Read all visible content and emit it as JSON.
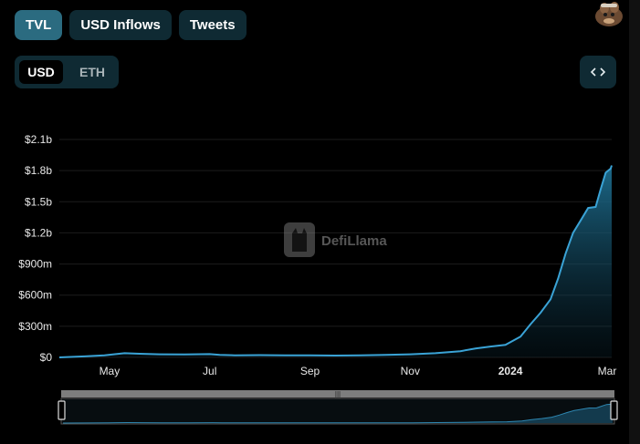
{
  "tabs": [
    {
      "label": "TVL",
      "active": true
    },
    {
      "label": "USD Inflows",
      "active": false
    },
    {
      "label": "Tweets",
      "active": false
    }
  ],
  "denomination": {
    "options": [
      "USD",
      "ETH"
    ],
    "selected": "USD"
  },
  "embed_icon": "code-brackets-icon",
  "avatar_icon": "llama-avatar-icon",
  "watermark": "DefiLlama",
  "colors": {
    "line": "#3aa3d6",
    "accent": "#2b6b80",
    "panel": "#0f2a33"
  },
  "chart_data": {
    "type": "area",
    "title": "",
    "xlabel": "",
    "ylabel": "",
    "x_tick_labels": [
      "May",
      "Jul",
      "Sep",
      "Nov",
      "2024",
      "Mar"
    ],
    "x_tick_months": [
      4,
      6,
      8,
      10,
      12,
      14
    ],
    "x_range_months": [
      3,
      14.02
    ],
    "y_tick_labels": [
      "$0",
      "$300m",
      "$600m",
      "$900m",
      "$1.2b",
      "$1.5b",
      "$1.8b",
      "$2.1b"
    ],
    "y_tick_values": [
      0,
      300,
      600,
      900,
      1200,
      1500,
      1800,
      2100
    ],
    "ylim": [
      0,
      2100
    ],
    "y_unit": "USD millions",
    "grid": true,
    "series": [
      {
        "x": [
          3.0,
          3.5,
          3.9,
          4.3,
          4.6,
          5.0,
          5.5,
          6.0,
          6.2,
          6.5,
          7.0,
          7.5,
          8.0,
          8.5,
          9.0,
          9.5,
          10.0,
          10.5,
          11.0,
          11.3,
          11.6,
          11.9,
          12.2,
          12.4,
          12.6,
          12.8,
          12.95,
          13.1,
          13.25,
          13.4,
          13.55,
          13.7,
          13.8,
          13.9,
          14.0,
          14.02
        ],
        "y": [
          0,
          10,
          20,
          40,
          35,
          30,
          28,
          32,
          25,
          20,
          22,
          20,
          20,
          18,
          20,
          25,
          30,
          40,
          60,
          85,
          105,
          120,
          200,
          320,
          430,
          560,
          760,
          1000,
          1200,
          1320,
          1440,
          1450,
          1620,
          1780,
          1820,
          1850
        ]
      }
    ]
  }
}
